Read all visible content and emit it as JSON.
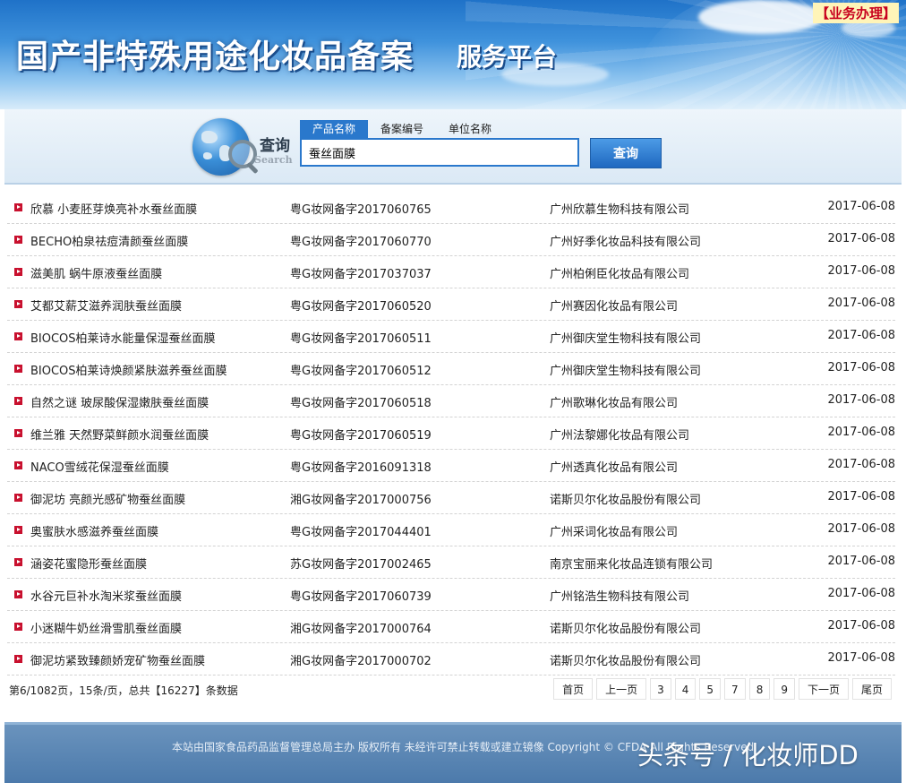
{
  "header": {
    "title": "国产非特殊用途化妆品备案",
    "subtitle": "服务平台",
    "business_link": "【业务办理】"
  },
  "search": {
    "label_cn": "查询",
    "label_en": "Search",
    "tabs": [
      {
        "label": "产品名称",
        "active": true
      },
      {
        "label": "备案编号",
        "active": false
      },
      {
        "label": "单位名称",
        "active": false
      }
    ],
    "query": "蚕丝面膜",
    "button_label": "查询"
  },
  "results": [
    {
      "name": "欣慕 小麦胚芽焕亮补水蚕丝面膜",
      "code": "粤G妆网备字2017060765",
      "company": "广州欣慕生物科技有限公司",
      "date": "2017-06-08"
    },
    {
      "name": "BECHO柏泉祛痘清颜蚕丝面膜",
      "code": "粤G妆网备字2017060770",
      "company": "广州好季化妆品科技有限公司",
      "date": "2017-06-08"
    },
    {
      "name": "滋美肌 蜗牛原液蚕丝面膜",
      "code": "粤G妆网备字2017037037",
      "company": "广州柏俐臣化妆品有限公司",
      "date": "2017-06-08"
    },
    {
      "name": "艾都艾薪艾滋养润肤蚕丝面膜",
      "code": "粤G妆网备字2017060520",
      "company": "广州赛因化妆品有限公司",
      "date": "2017-06-08"
    },
    {
      "name": "BIOCOS柏莱诗水能量保湿蚕丝面膜",
      "code": "粤G妆网备字2017060511",
      "company": "广州御庆堂生物科技有限公司",
      "date": "2017-06-08"
    },
    {
      "name": "BIOCOS柏莱诗焕颜紧肤滋养蚕丝面膜",
      "code": "粤G妆网备字2017060512",
      "company": "广州御庆堂生物科技有限公司",
      "date": "2017-06-08"
    },
    {
      "name": "自然之谜 玻尿酸保湿嫩肤蚕丝面膜",
      "code": "粤G妆网备字2017060518",
      "company": "广州歌琳化妆品有限公司",
      "date": "2017-06-08"
    },
    {
      "name": "维兰雅 天然野菜鲜颜水润蚕丝面膜",
      "code": "粤G妆网备字2017060519",
      "company": "广州法黎娜化妆品有限公司",
      "date": "2017-06-08"
    },
    {
      "name": "NACO雪绒花保湿蚕丝面膜",
      "code": "粤G妆网备字2016091318",
      "company": "广州透真化妆品有限公司",
      "date": "2017-06-08"
    },
    {
      "name": "御泥坊 亮颜光感矿物蚕丝面膜",
      "code": "湘G妆网备字2017000756",
      "company": "诺斯贝尔化妆品股份有限公司",
      "date": "2017-06-08"
    },
    {
      "name": "奥蜜肤水感滋养蚕丝面膜",
      "code": "粤G妆网备字2017044401",
      "company": "广州采词化妆品有限公司",
      "date": "2017-06-08"
    },
    {
      "name": "涵姿花蜜隐形蚕丝面膜",
      "code": "苏G妆网备字2017002465",
      "company": "南京宝丽来化妆品连锁有限公司",
      "date": "2017-06-08"
    },
    {
      "name": "水谷元巨补水淘米浆蚕丝面膜",
      "code": "粤G妆网备字2017060739",
      "company": "广州铭浩生物科技有限公司",
      "date": "2017-06-08"
    },
    {
      "name": "小迷糊牛奶丝滑雪肌蚕丝面膜",
      "code": "湘G妆网备字2017000764",
      "company": "诺斯贝尔化妆品股份有限公司",
      "date": "2017-06-08"
    },
    {
      "name": "御泥坊紧致臻颜娇宠矿物蚕丝面膜",
      "code": "湘G妆网备字2017000702",
      "company": "诺斯贝尔化妆品股份有限公司",
      "date": "2017-06-08"
    }
  ],
  "pager": {
    "info": "第6/1082页，15条/页，总共【16227】条数据",
    "first": "首页",
    "prev": "上一页",
    "pages": [
      "3",
      "4",
      "5",
      "7",
      "8",
      "9"
    ],
    "next": "下一页",
    "last": "尾页"
  },
  "footer": {
    "text": "本站由国家食品药品监督管理总局主办 版权所有 未经许可禁止转载或建立镜像 Copyright © CFDA All Rights Reserved",
    "watermark": "头条号 / 化妆师DD"
  },
  "colors": {
    "accent": "#2a78cc",
    "bullet": "#c8102e",
    "footer_bg": "#5a86b4"
  }
}
